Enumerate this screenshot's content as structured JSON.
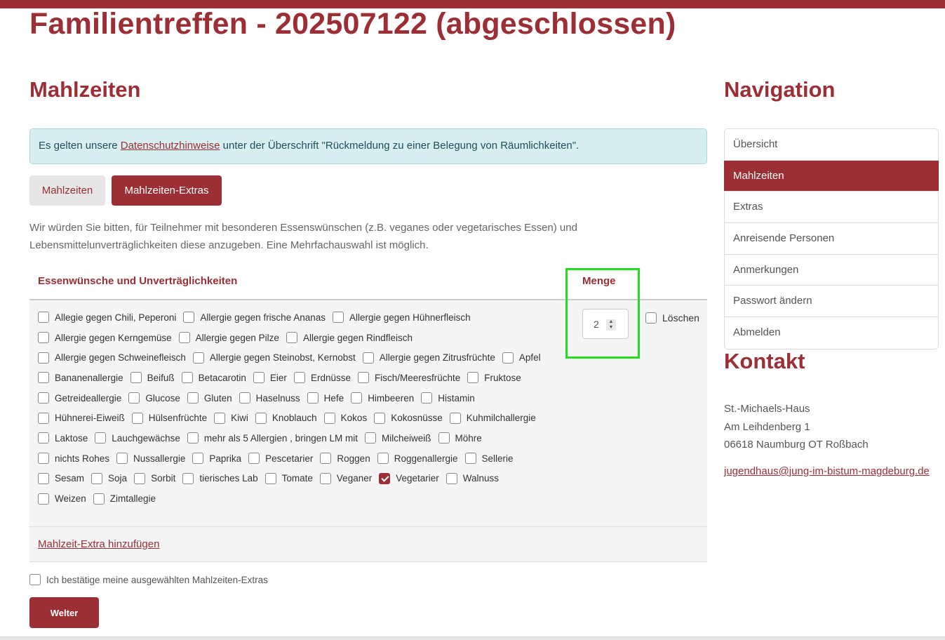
{
  "page": {
    "title": "Familientreffen - 202507122 (abgeschlossen)",
    "section_title": "Mahlzeiten"
  },
  "alert": {
    "prefix": "Es gelten unsere ",
    "link": "Datenschutzhinweise",
    "suffix": " unter der Überschrift \"Rückmeldung zu einer Belegung von Räumlichkeiten\"."
  },
  "tabs": [
    {
      "label": "Mahlzeiten",
      "active": false
    },
    {
      "label": "Mahlzeiten-Extras",
      "active": true
    }
  ],
  "intro": "Wir würden Sie bitten, für Teilnehmer mit besonderen Essenswünschen (z.B. veganes oder vegetarisches Essen) und Lebensmittelunverträglichkeiten diese anzugeben. Eine Mehrfachauswahl ist möglich.",
  "table": {
    "col_wishes": "Essenwünsche und Unverträglichkeiten",
    "col_qty": "Menge",
    "qty_value": "2",
    "delete_label": "Löschen",
    "options": [
      {
        "label": "Allegie gegen Chili, Peperoni",
        "checked": false
      },
      {
        "label": "Allergie gegen frische Ananas",
        "checked": false
      },
      {
        "label": "Allergie gegen Hühnerfleisch",
        "checked": false
      },
      {
        "label": "Allergie gegen Kerngemüse",
        "checked": false
      },
      {
        "label": "Allergie gegen Pilze",
        "checked": false
      },
      {
        "label": "Allergie gegen Rindfleisch",
        "checked": false
      },
      {
        "label": "Allergie gegen Schweinefleisch",
        "checked": false
      },
      {
        "label": "Allergie gegen Steinobst, Kernobst",
        "checked": false
      },
      {
        "label": "Allergie gegen Zitrusfrüchte",
        "checked": false
      },
      {
        "label": "Apfel",
        "checked": false
      },
      {
        "label": "Bananenallergie",
        "checked": false
      },
      {
        "label": "Beifuß",
        "checked": false
      },
      {
        "label": "Betacarotin",
        "checked": false
      },
      {
        "label": "Eier",
        "checked": false
      },
      {
        "label": "Erdnüsse",
        "checked": false
      },
      {
        "label": "Fisch/Meeresfrüchte",
        "checked": false
      },
      {
        "label": "Fruktose",
        "checked": false
      },
      {
        "label": "Getreideallergie",
        "checked": false
      },
      {
        "label": "Glucose",
        "checked": false
      },
      {
        "label": "Gluten",
        "checked": false
      },
      {
        "label": "Haselnuss",
        "checked": false
      },
      {
        "label": "Hefe",
        "checked": false
      },
      {
        "label": "Himbeeren",
        "checked": false
      },
      {
        "label": "Histamin",
        "checked": false
      },
      {
        "label": "Hühnerei-Eiweiß",
        "checked": false
      },
      {
        "label": "Hülsenfrüchte",
        "checked": false
      },
      {
        "label": "Kiwi",
        "checked": false
      },
      {
        "label": "Knoblauch",
        "checked": false
      },
      {
        "label": "Kokos",
        "checked": false
      },
      {
        "label": "Kokosnüsse",
        "checked": false
      },
      {
        "label": "Kuhmilchallergie",
        "checked": false
      },
      {
        "label": "Laktose",
        "checked": false
      },
      {
        "label": "Lauchgewächse",
        "checked": false
      },
      {
        "label": "mehr als 5 Allergien , bringen LM mit",
        "checked": false
      },
      {
        "label": "Milcheiweiß",
        "checked": false
      },
      {
        "label": "Möhre",
        "checked": false
      },
      {
        "label": "nichts Rohes",
        "checked": false
      },
      {
        "label": "Nussallergie",
        "checked": false
      },
      {
        "label": "Paprika",
        "checked": false
      },
      {
        "label": "Pescetarier",
        "checked": false
      },
      {
        "label": "Roggen",
        "checked": false
      },
      {
        "label": "Roggenallergie",
        "checked": false
      },
      {
        "label": "Sellerie",
        "checked": false
      },
      {
        "label": "Sesam",
        "checked": false
      },
      {
        "label": "Soja",
        "checked": false
      },
      {
        "label": "Sorbit",
        "checked": false
      },
      {
        "label": "tierisches Lab",
        "checked": false
      },
      {
        "label": "Tomate",
        "checked": false
      },
      {
        "label": "Veganer",
        "checked": false
      },
      {
        "label": "Vegetarier",
        "checked": true
      },
      {
        "label": "Walnuss",
        "checked": false
      },
      {
        "label": "Weizen",
        "checked": false
      },
      {
        "label": "Zimtallegie",
        "checked": false
      }
    ]
  },
  "add_extra": "Mahlzeit-Extra hinzufügen",
  "confirm_label": "Ich bestätige meine ausgewählten Mahlzeiten-Extras",
  "next_button": "Welter",
  "sidebar": {
    "nav_title": "Navigation",
    "items": [
      {
        "label": "Übersicht",
        "active": false
      },
      {
        "label": "Mahlzeiten",
        "active": true
      },
      {
        "label": "Extras",
        "active": false
      },
      {
        "label": "Anreisende Personen",
        "active": false
      },
      {
        "label": "Anmerkungen",
        "active": false
      },
      {
        "label": "Passwort ändern",
        "active": false
      },
      {
        "label": "Abmelden",
        "active": false
      }
    ],
    "contact_title": "Kontakt",
    "contact_lines": [
      "St.-Michaels-Haus",
      "Am Leihdenberg 1",
      "06618 Naumburg OT Roßbach"
    ],
    "email": "jugendhaus@jung-im-bistum-magdeburg.de"
  },
  "colors": {
    "accent": "#9b2f35",
    "alert_bg": "#d8eef1",
    "highlight": "#22dd22"
  }
}
